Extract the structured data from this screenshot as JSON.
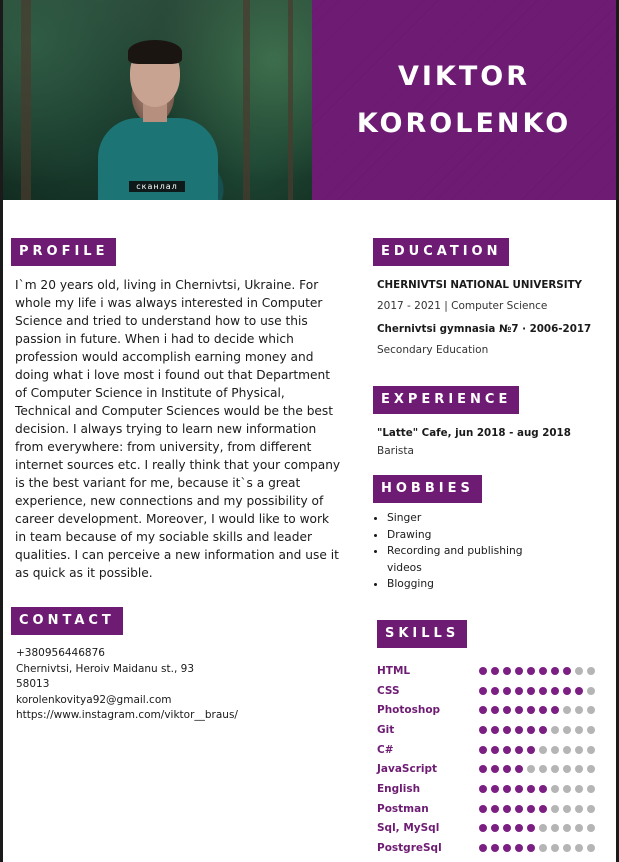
{
  "header": {
    "first_name": "VIKTOR",
    "last_name": "KOROLENKO",
    "shirt_text": "сканлал"
  },
  "colors": {
    "accent": "#6e1c73",
    "dot_on": "#7b1f83",
    "dot_off": "#b5b5b5"
  },
  "profile": {
    "heading": "PROFILE",
    "text": "I`m 20 years old, living in Chernivtsi, Ukraine. For whole my life i was always interested in Computer Science and tried to understand how to use this passion in future. When i had to decide which profession would accomplish earning money and doing what i love most i found out that Department of Computer Science in Institute of Physical, Technical and Computer Sciences would be the best decision. I always trying to learn new information from everywhere: from university, from different internet sources etc. I really think that your company is the best variant for me, because it`s a great experience, new connections and my possibility of career development. Moreover, I would like to work in team because of my sociable skills and leader qualities. I can perceive a new information and use it as quick as it possible."
  },
  "contact": {
    "heading": "CONTACT",
    "phone": "+380956446876",
    "address": "Chernivtsi, Heroiv Maidanu st., 93",
    "zip": "58013",
    "email": "korolenkovitya92@gmail.com",
    "instagram": "https://www.instagram.com/viktor__braus/"
  },
  "education": {
    "heading": "EDUCATION",
    "items": [
      {
        "institution": "CHERNIVTSI NATIONAL UNIVERSITY",
        "detail": "2017 - 2021 | Computer Science"
      },
      {
        "institution": "Chernivtsi gymnasia №7 · 2006-2017",
        "detail": "Secondary Education"
      }
    ]
  },
  "experience": {
    "heading": "EXPERIENCE",
    "items": [
      {
        "title": "\"Latte\" Cafe, jun 2018 - aug 2018",
        "role": "Barista"
      }
    ]
  },
  "hobbies": {
    "heading": "HOBBIES",
    "items": [
      "Singer",
      "Drawing",
      "Recording and publishing videos",
      "Blogging"
    ]
  },
  "skills": {
    "heading": "SKILLS",
    "max": 10,
    "items": [
      {
        "name": "HTML",
        "level": 8
      },
      {
        "name": "CSS",
        "level": 9
      },
      {
        "name": "Photoshop",
        "level": 7
      },
      {
        "name": "Git",
        "level": 6
      },
      {
        "name": "C#",
        "level": 5
      },
      {
        "name": "JavaScript",
        "level": 4
      },
      {
        "name": "English",
        "level": 6
      },
      {
        "name": "Postman",
        "level": 6
      },
      {
        "name": "Sql, MySql",
        "level": 5
      },
      {
        "name": "PostgreSql",
        "level": 5
      }
    ]
  }
}
